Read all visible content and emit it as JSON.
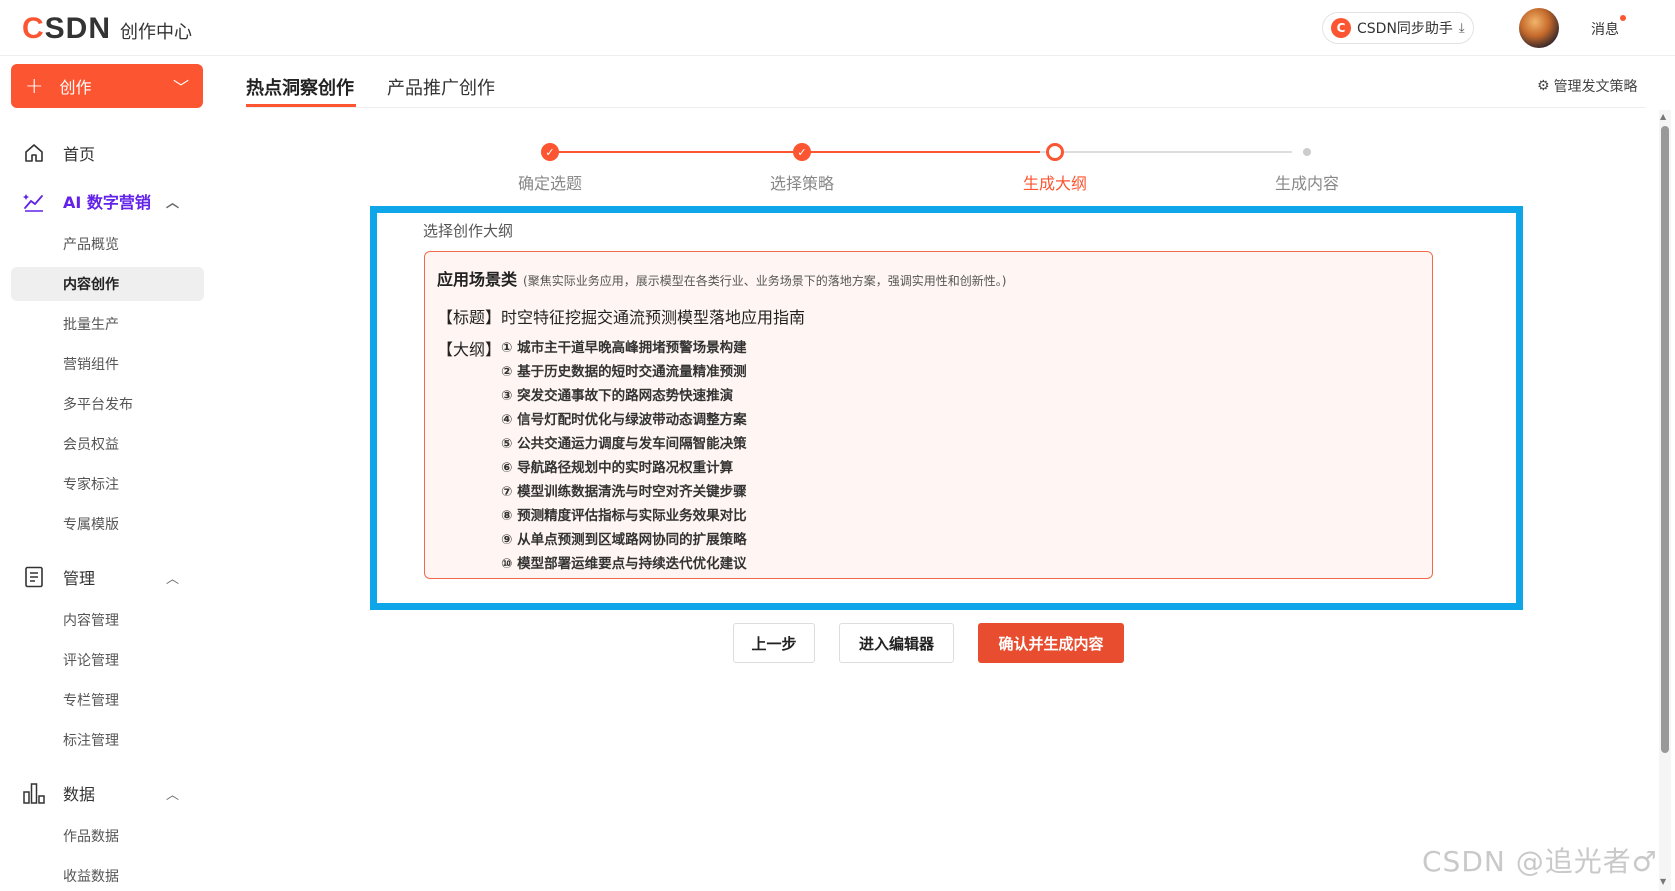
{
  "header": {
    "logo": "CSDN",
    "center_title": "创作中心",
    "sync_label": "CSDN同步助手",
    "messages_label": "消息"
  },
  "sidebar": {
    "create_label": "创作",
    "home_label": "首页",
    "groups": [
      {
        "label": "AI 数字营销",
        "items": [
          "产品概览",
          "内容创作",
          "批量生产",
          "营销组件",
          "多平台发布",
          "会员权益",
          "专家标注",
          "专属模版"
        ],
        "active": "内容创作"
      },
      {
        "label": "管理",
        "items": [
          "内容管理",
          "评论管理",
          "专栏管理",
          "标注管理"
        ]
      },
      {
        "label": "数据",
        "items": [
          "作品数据",
          "收益数据"
        ]
      }
    ]
  },
  "tabs": {
    "items": [
      "热点洞察创作",
      "产品推广创作"
    ],
    "active": "热点洞察创作",
    "manage_label": "管理发文策略"
  },
  "stepper": {
    "steps": [
      "确定选题",
      "选择策略",
      "生成大纲",
      "生成内容"
    ],
    "current_index": 2
  },
  "outline": {
    "section_title": "选择创作大纲",
    "category": "应用场景类",
    "category_desc": "(聚焦实际业务应用，展示模型在各类行业、业务场景下的落地方案，强调实用性和创新性。)",
    "title_line": "【标题】时空特征挖掘交通流预测模型落地应用指南",
    "outline_label": "【大纲】",
    "items": [
      "① 城市主干道早晚高峰拥堵预警场景构建",
      "② 基于历史数据的短时交通流量精准预测",
      "③ 突发交通事故下的路网态势快速推演",
      "④ 信号灯配时优化与绿波带动态调整方案",
      "⑤ 公共交通运力调度与发车间隔智能决策",
      "⑥ 导航路径规划中的实时路况权重计算",
      "⑦ 模型训练数据清洗与时空对齐关键步骤",
      "⑧ 预测精度评估指标与实际业务效果对比",
      "⑨ 从单点预测到区域路网协同的扩展策略",
      "⑩ 模型部署运维要点与持续迭代优化建议"
    ]
  },
  "actions": {
    "prev_label": "上一步",
    "editor_label": "进入编辑器",
    "confirm_label": "确认并生成内容"
  },
  "watermark": "CSDN @追光者♂",
  "colors": {
    "brand": "#fc5531",
    "ai_purple": "#6222e8",
    "highlight_frame": "#0ea5e9"
  }
}
